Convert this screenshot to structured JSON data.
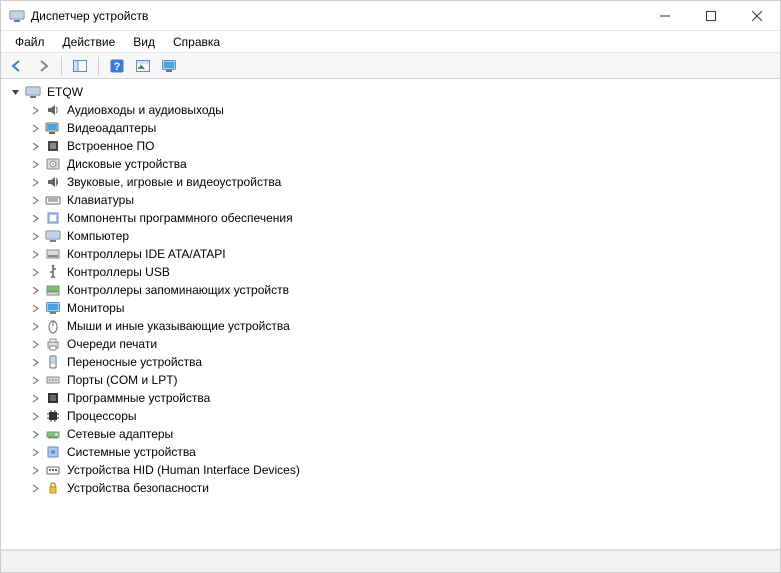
{
  "window": {
    "title": "Диспетчер устройств"
  },
  "menu": {
    "file": "Файл",
    "action": "Действие",
    "view": "Вид",
    "help": "Справка"
  },
  "toolbar": {
    "back_icon": "back-icon",
    "forward_icon": "forward-icon",
    "show_hide_icon": "panel-icon",
    "help_icon": "help-icon",
    "refresh_icon": "refresh-icon",
    "monitor_icon": "monitor-icon"
  },
  "tree": {
    "root": {
      "label": "ETQW",
      "icon": "computer-icon",
      "expanded": true
    },
    "categories": [
      {
        "label": "Аудиовходы и аудиовыходы",
        "icon": "audio-icon"
      },
      {
        "label": "Видеоадаптеры",
        "icon": "display-adapter-icon"
      },
      {
        "label": "Встроенное ПО",
        "icon": "firmware-icon"
      },
      {
        "label": "Дисковые устройства",
        "icon": "disk-icon"
      },
      {
        "label": "Звуковые, игровые и видеоустройства",
        "icon": "sound-icon"
      },
      {
        "label": "Клавиатуры",
        "icon": "keyboard-icon"
      },
      {
        "label": "Компоненты программного обеспечения",
        "icon": "software-component-icon"
      },
      {
        "label": "Компьютер",
        "icon": "computer-icon"
      },
      {
        "label": "Контроллеры IDE ATA/ATAPI",
        "icon": "ide-icon"
      },
      {
        "label": "Контроллеры USB",
        "icon": "usb-icon"
      },
      {
        "label": "Контроллеры запоминающих устройств",
        "icon": "storage-controller-icon"
      },
      {
        "label": "Мониторы",
        "icon": "monitor-icon"
      },
      {
        "label": "Мыши и иные указывающие устройства",
        "icon": "mouse-icon"
      },
      {
        "label": "Очереди печати",
        "icon": "printer-icon"
      },
      {
        "label": "Переносные устройства",
        "icon": "portable-device-icon"
      },
      {
        "label": "Порты (COM и LPT)",
        "icon": "port-icon"
      },
      {
        "label": "Программные устройства",
        "icon": "software-device-icon"
      },
      {
        "label": "Процессоры",
        "icon": "cpu-icon"
      },
      {
        "label": "Сетевые адаптеры",
        "icon": "network-icon"
      },
      {
        "label": "Системные устройства",
        "icon": "system-device-icon"
      },
      {
        "label": "Устройства HID (Human Interface Devices)",
        "icon": "hid-icon"
      },
      {
        "label": "Устройства безопасности",
        "icon": "security-device-icon"
      }
    ]
  }
}
